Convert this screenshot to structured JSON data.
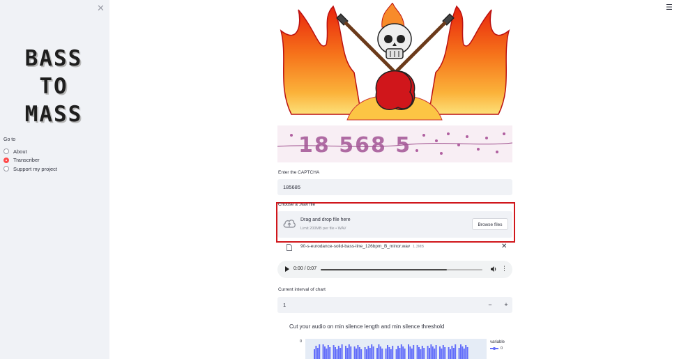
{
  "sidebar": {
    "logo_lines": [
      "BASS",
      "TO",
      "MASS"
    ],
    "goto_label": "Go to",
    "nav": [
      {
        "label": "About",
        "selected": false
      },
      {
        "label": "Transcriber",
        "selected": true
      },
      {
        "label": "Support my project",
        "selected": false
      }
    ]
  },
  "captcha": {
    "image_text": "18 568 5",
    "label": "Enter the CAPTCHA",
    "value": "185685"
  },
  "uploader": {
    "label": "Choose a .wav file",
    "drop_title": "Drag and drop file here",
    "limit": "Limit 200MB per file • WAV",
    "browse_label": "Browse files"
  },
  "file": {
    "name": "90-s-eurodance-solid-bass-line_126bpm_B_minor.wav",
    "size": "1.3MB"
  },
  "audio": {
    "time": "0:00 / 0:07",
    "progress": 0.78
  },
  "interval": {
    "label": "Current interval of chart",
    "value": "1",
    "minus": "−",
    "plus": "+"
  },
  "chart": {
    "title": "Cut your audio on min silence length and min silence threshold",
    "y_tick": "0",
    "legend_title": "variable",
    "legend_item": "0",
    "bar_color": "#636efa"
  },
  "colors": {
    "accent": "#ff4b4b",
    "highlight_frame": "#d0161b",
    "sidebar_bg": "#f0f2f6"
  }
}
